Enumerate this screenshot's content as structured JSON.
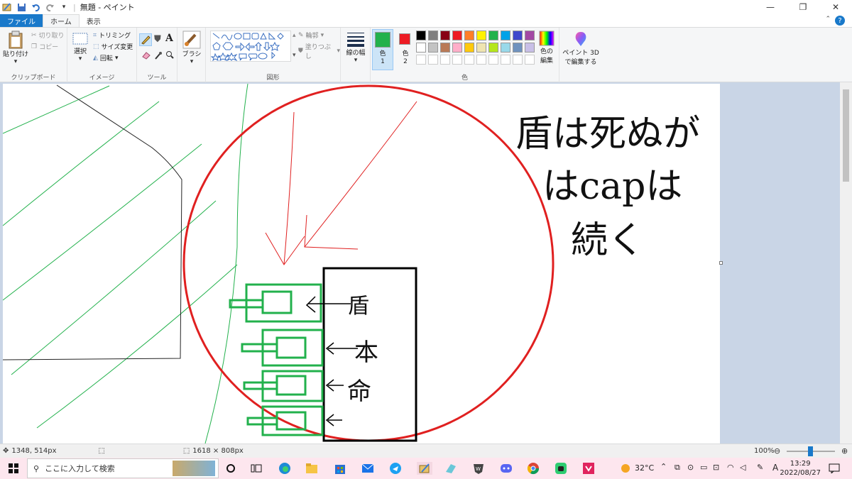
{
  "window": {
    "title": "無題 - ペイント"
  },
  "tabs": {
    "file": "ファイル",
    "home": "ホーム",
    "view": "表示"
  },
  "ribbon": {
    "clipboard": {
      "paste": "貼り付け",
      "cut": "切り取り",
      "copy": "コピー",
      "label": "クリップボード"
    },
    "image": {
      "select": "選択",
      "crop": "トリミング",
      "resize": "サイズ変更",
      "rotate": "回転",
      "label": "イメージ"
    },
    "tools": {
      "label": "ツール"
    },
    "brushes": {
      "label": "ブラシ"
    },
    "shapes": {
      "outline": "輪郭",
      "fill": "塗りつぶし",
      "label": "図形"
    },
    "line_width": {
      "label": "線の幅"
    },
    "colors": {
      "color1_label": "色",
      "color1_num": "1",
      "color2_label": "色",
      "color2_num": "2",
      "edit_colors_line1": "色の",
      "edit_colors_line2": "編集",
      "label": "色",
      "color1": "#22b14c",
      "color2": "#ed1c24",
      "palette_row1": [
        "#000000",
        "#7f7f7f",
        "#880015",
        "#ed1c24",
        "#ff7f27",
        "#fff200",
        "#22b14c",
        "#00a2e8",
        "#3f48cc",
        "#a349a4"
      ],
      "palette_row2": [
        "#ffffff",
        "#c3c3c3",
        "#b97a57",
        "#ffaec9",
        "#ffc90e",
        "#efe4b0",
        "#b5e61d",
        "#99d9ea",
        "#7092be",
        "#c8bfe7"
      ]
    },
    "paint3d": {
      "line1": "ペイント 3D",
      "line2": "で編集する"
    }
  },
  "status": {
    "cursor": "1348, 514px",
    "canvas_size": "1618 × 808px",
    "zoom": "100%"
  },
  "taskbar": {
    "search_placeholder": "ここに入力して検索",
    "temperature": "32°C",
    "ime": "A",
    "time": "13:29",
    "date": "2022/08/27"
  },
  "drawing": {
    "text_line1": "盾は死ぬが",
    "text_line2": "はcapは",
    "text_line3": "続く",
    "label_1": "盾",
    "label_2": "本",
    "label_3": "命"
  }
}
